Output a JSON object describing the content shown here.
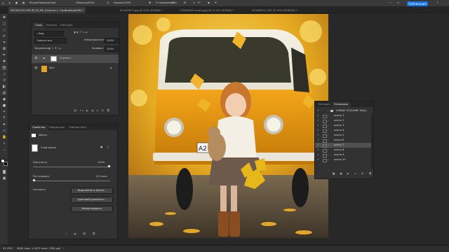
{
  "optbar": {
    "mode_label": "Режим:",
    "mode_value": "Нормальный",
    "opacity_label": "Непрозр.:",
    "opacity_value": "100%",
    "pressure_label": "Нажим:",
    "pressure_value": "100%",
    "smoothing_label": "Сглаживание:",
    "smoothing_value": "10%",
    "angle_value": "0°",
    "publish": "Публикация"
  },
  "tabs": [
    {
      "label": "9O1A0125.CR3 @ 42,3% (Группа 1, Слой-маска/16) *",
      "active": true
    },
    {
      "label": "9C0A4673.jpg @ 50% (RGB/8) *",
      "active": false
    },
    {
      "label": "7V5A9626 копия.jpg @ 41,4% (RGB/8) *",
      "active": false
    },
    {
      "label": "9C0A6021.CR2 @ 50% (RGB/16) *",
      "active": false
    }
  ],
  "layers_panel": {
    "tabs": [
      "Слои",
      "Каналы",
      "Контуры"
    ],
    "filter_value": "Вид",
    "blend_value": "Пропустить",
    "opacity_label": "Непрозрачность:",
    "opacity_value": "100%",
    "lock_label": "Закрепить:",
    "fill_label": "Заливка:",
    "fill_value": "100%",
    "layers": [
      {
        "name": "Группа 1",
        "type": "group"
      },
      {
        "name": "Фон",
        "type": "background"
      }
    ]
  },
  "properties_panel": {
    "tabs": [
      "Свойства",
      "Коррекция",
      "Библиотеки"
    ],
    "section_masks": "Маски",
    "mask_name": "Слой-маска",
    "density_label": "Плотность:",
    "density_value": "100%",
    "feather_label": "Растушевка:",
    "feather_value": "0,0 пикс.",
    "refine_label": "Уточнить:",
    "buttons": [
      "Выделение и маска...",
      "Цветовой диапазон...",
      "Инвертировать"
    ]
  },
  "actions_panel": {
    "tabs": [
      "История",
      "Операции"
    ],
    "set_name": "НОВЫЕ ОСЕННИЕ ЭКШ...",
    "items": [
      {
        "label": "осень 1",
        "selected": false
      },
      {
        "label": "осень 2",
        "selected": false
      },
      {
        "label": "осень 3",
        "selected": false
      },
      {
        "label": "осень 4",
        "selected": false
      },
      {
        "label": "осень 5",
        "selected": false
      },
      {
        "label": "осень 6",
        "selected": false
      },
      {
        "label": "осень 7",
        "selected": true
      },
      {
        "label": "осень 8",
        "selected": false
      },
      {
        "label": "осень 9",
        "selected": false
      },
      {
        "label": "осень 10",
        "selected": false
      }
    ]
  },
  "photo": {
    "plate_text": "A2"
  },
  "status": {
    "zoom": "42,29%",
    "size": "3840 пикс. x 5472 пикс. (300 ppi)"
  },
  "colors": {
    "accent": "#1473e6",
    "panel_bg": "#323232",
    "van_orange": "#e99a12"
  }
}
